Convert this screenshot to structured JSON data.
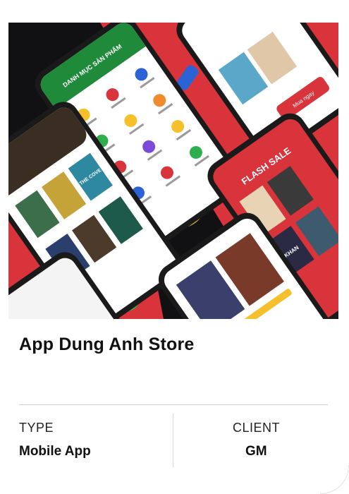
{
  "project": {
    "title": "App Dung Anh Store",
    "hero_image_alt": "Mobile app screenshots collage"
  },
  "meta": {
    "type_label": "TYPE",
    "type_value": "Mobile App",
    "client_label": "CLIENT",
    "client_value": "GM"
  },
  "hero_texts": {
    "category_header": "DANH MỤC SẢN PHẨM",
    "flash_sale": "FLASH SALE",
    "book_cover_1": "THE COVE",
    "book_cover_2": "KHAN",
    "buy_button": "Mua ngay"
  },
  "colors": {
    "brand_red": "#d9343b",
    "brand_green": "#1f8a3a",
    "hero_bg": "#0f0f12",
    "accent_orange": "#f08a2c",
    "accent_blue": "#2b62d6",
    "accent_yellow": "#f6c02c"
  }
}
